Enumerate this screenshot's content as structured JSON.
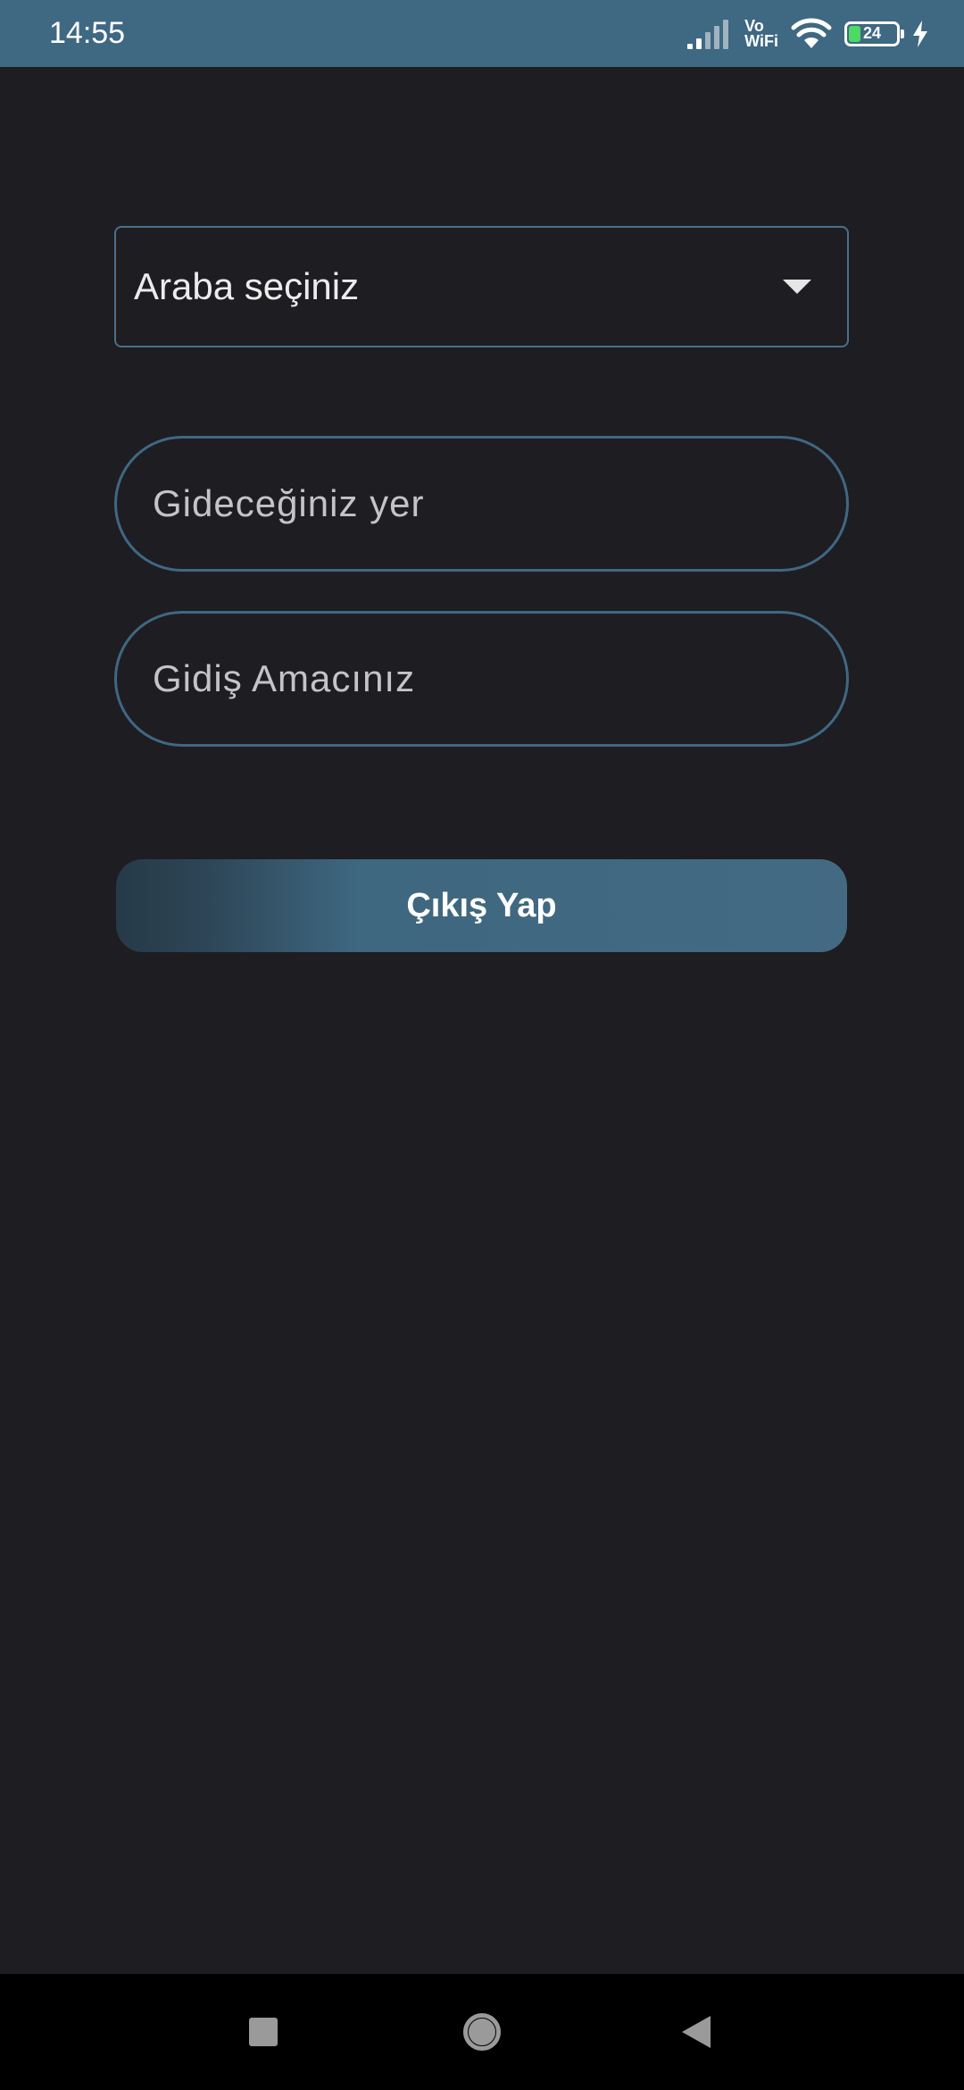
{
  "status_bar": {
    "time": "14:55",
    "network_label_top": "Vo",
    "network_label_bottom": "WiFi",
    "battery_level": "24",
    "icons": [
      "signal-icon",
      "wifi-icon",
      "battery-icon",
      "charging-icon"
    ],
    "background_color": "#3f6882"
  },
  "form": {
    "car_select": {
      "label": "Araba seçiniz",
      "icon": "chevron-down-icon"
    },
    "destination": {
      "placeholder": "Gideceğiniz yer",
      "value": ""
    },
    "purpose": {
      "placeholder": "Gidiş Amacınız",
      "value": ""
    },
    "exit_button": {
      "label": "Çıkış Yap"
    }
  },
  "nav_bar": {
    "buttons": [
      "recents-icon",
      "home-icon",
      "back-icon"
    ]
  },
  "colors": {
    "background": "#1e1d22",
    "accent": "#3f6882",
    "nav_background": "#000000"
  }
}
